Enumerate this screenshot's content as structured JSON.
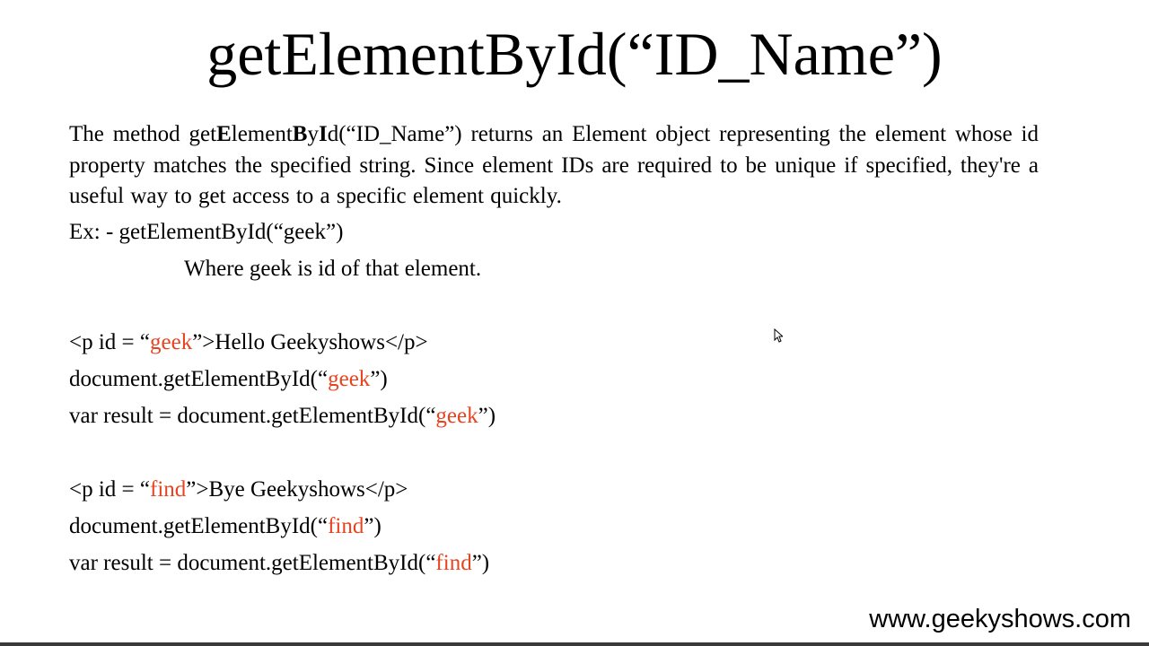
{
  "slide": {
    "title": "getElementById(“ID_Name”)",
    "description": {
      "part1": "The method get",
      "bold1": "E",
      "part2": "lement",
      "bold2": "B",
      "part3": "y",
      "bold3": "I",
      "part4": "d(“ID_Name”) returns an Element object representing the element whose id property matches the specified string. Since element IDs are required to be unique if specified, they're a useful way to get access to a specific element quickly."
    },
    "example": {
      "label": "Ex: - getElementById(“geek”)",
      "note": "Where geek is id of that element."
    },
    "code_block_1": {
      "line1_pre": "<p id = “",
      "line1_id": "geek",
      "line1_post": "”>Hello Geekyshows</p>",
      "line2_pre": "document.getElementById(“",
      "line2_id": "geek",
      "line2_post": "”)",
      "line3_pre": "var result = document.getElementById(“",
      "line3_id": "geek",
      "line3_post": "”)"
    },
    "code_block_2": {
      "line1_pre": "<p id = “",
      "line1_id": "find",
      "line1_post": "”>Bye Geekyshows</p>",
      "line2_pre": "document.getElementById(“",
      "line2_id": "find",
      "line2_post": "”)",
      "line3_pre": "var result = document.getElementById(“",
      "line3_id": "find",
      "line3_post": "”)"
    },
    "footer_url": "www.geekyshows.com"
  },
  "colors": {
    "highlight": "#e8421f",
    "text": "#000000",
    "background": "#ffffff"
  },
  "icons": {
    "cursor": "mouse-pointer-icon"
  }
}
